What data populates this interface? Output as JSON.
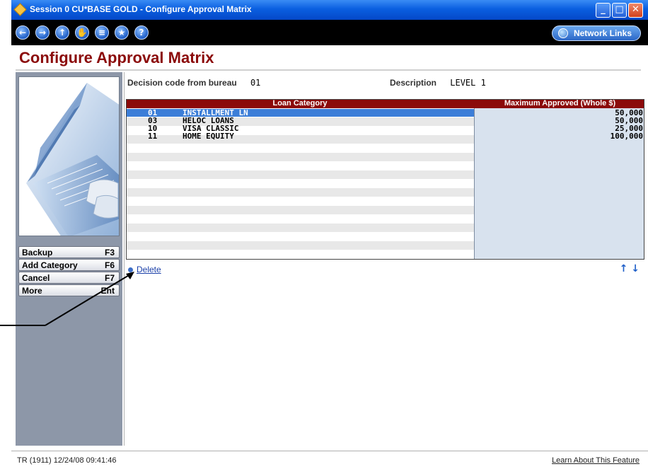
{
  "window": {
    "title": "Session 0 CU*BASE GOLD - Configure Approval Matrix",
    "controls": {
      "minimize": "_",
      "maximize": "□",
      "close": "✕"
    }
  },
  "toolbar": {
    "nav_icons": [
      "back-icon",
      "forward-icon",
      "up-icon",
      "hand-icon",
      "print-icon",
      "favorite-icon",
      "help-icon"
    ],
    "nav_glyphs": [
      "←",
      "→",
      "↑",
      "✋",
      "≡",
      "★",
      "?"
    ],
    "network_links_label": "Network Links"
  },
  "page": {
    "title": "Configure Approval Matrix"
  },
  "header_fields": {
    "decision_code_label": "Decision code from bureau",
    "decision_code_value": "01",
    "description_label": "Description",
    "description_value": "LEVEL 1"
  },
  "grid": {
    "columns": [
      "Loan Category",
      "Maximum Approved (Whole $)"
    ],
    "rows": [
      {
        "code": "01",
        "desc": "INSTALLMENT LN",
        "amount": "50,000",
        "selected": true
      },
      {
        "code": "03",
        "desc": "HELOC LOANS",
        "amount": "50,000",
        "selected": false
      },
      {
        "code": "10",
        "desc": "VISA CLASSIC",
        "amount": "25,000",
        "selected": false
      },
      {
        "code": "11",
        "desc": "HOME EQUITY",
        "amount": "100,000",
        "selected": false
      }
    ]
  },
  "actions": {
    "delete_label": "Delete"
  },
  "function_keys": [
    {
      "label": "Backup",
      "key": "F3"
    },
    {
      "label": "Add Category",
      "key": "F6"
    },
    {
      "label": "Cancel",
      "key": "F7"
    },
    {
      "label": "More",
      "key": "Ent"
    }
  ],
  "paging": {
    "up": "↑",
    "down": "↓"
  },
  "status": {
    "left": "TR (1911) 12/24/08 09:41:46",
    "right": "Learn About This Feature"
  },
  "colors": {
    "title": "#8b0a0a",
    "grid_header": "#8b0a0a",
    "selection": "#3c7ed8",
    "left_panel": "#8d97a8",
    "titlebar": "#0a5fe0"
  }
}
